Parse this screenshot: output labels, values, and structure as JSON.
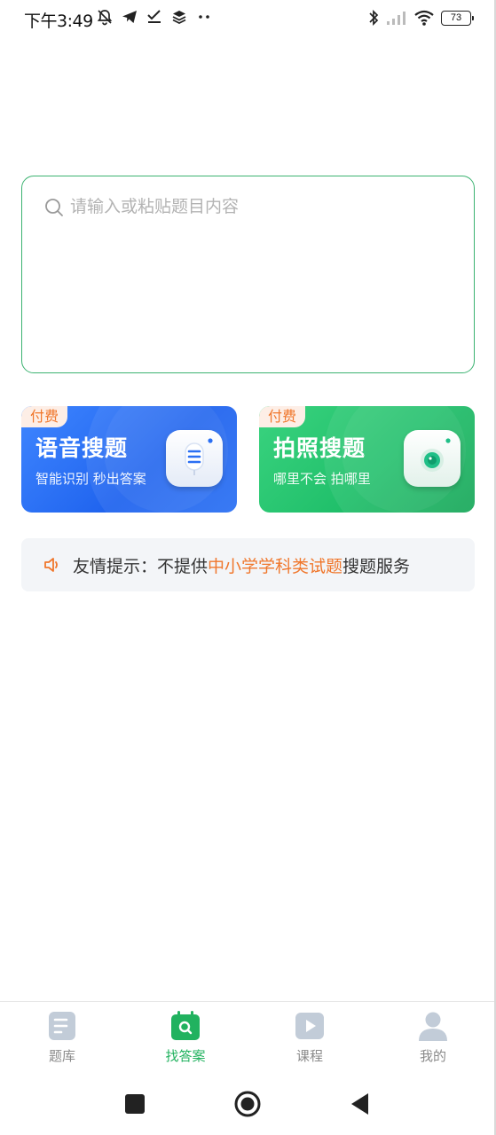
{
  "status_bar": {
    "time": "下午3:49",
    "battery": "73"
  },
  "search": {
    "placeholder": "请输入或粘贴题目内容",
    "value": ""
  },
  "cards": [
    {
      "badge": "付费",
      "title": "语音搜题",
      "subtitle": "智能识别 秒出答案",
      "icon": "microphone-icon"
    },
    {
      "badge": "付费",
      "title": "拍照搜题",
      "subtitle": "哪里不会 拍哪里",
      "icon": "camera-icon"
    }
  ],
  "notice": {
    "prefix": "友情提示：不提供",
    "highlight": "中小学学科类试题",
    "suffix": "搜题服务",
    "highlight_color": "#f0772c"
  },
  "tabs": [
    {
      "label": "题库",
      "icon": "document-icon",
      "active": false
    },
    {
      "label": "找答案",
      "icon": "calendar-search-icon",
      "active": true
    },
    {
      "label": "课程",
      "icon": "play-icon",
      "active": false
    },
    {
      "label": "我的",
      "icon": "user-icon",
      "active": false
    }
  ],
  "colors": {
    "accent_green": "#21b25f",
    "voice_card_blue": "#2a70f4",
    "photo_card_green": "#21c06b",
    "badge_orange": "#f0772c"
  }
}
